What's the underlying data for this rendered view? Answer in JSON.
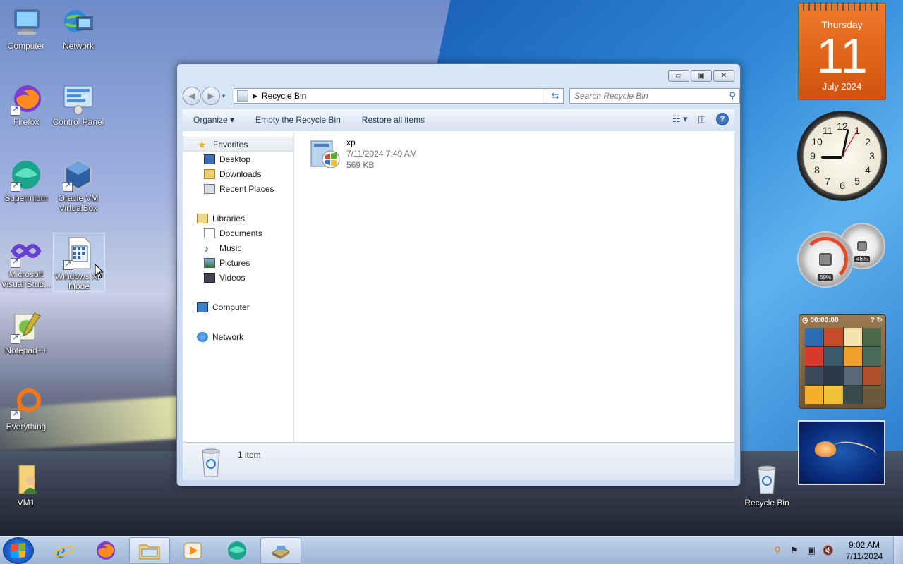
{
  "desktop_icons": [
    {
      "label": "Computer"
    },
    {
      "label": "Network"
    },
    {
      "label": "Firefox"
    },
    {
      "label": "Control Panel"
    },
    {
      "label": "Supermium"
    },
    {
      "label": "Oracle VM VirtualBox"
    },
    {
      "label": "Microsoft Visual Stud..."
    },
    {
      "label": "Windows XP Mode"
    },
    {
      "label": "Notepad++"
    },
    {
      "label": "Everything"
    },
    {
      "label": "VM1"
    },
    {
      "label": "Recycle Bin"
    }
  ],
  "window": {
    "address": "Recycle Bin",
    "search_placeholder": "Search Recycle Bin",
    "toolbar": {
      "organize": "Organize",
      "empty": "Empty the Recycle Bin",
      "restore": "Restore all items"
    },
    "nav": {
      "favorites": "Favorites",
      "desktop": "Desktop",
      "downloads": "Downloads",
      "recent": "Recent Places",
      "libraries": "Libraries",
      "documents": "Documents",
      "music": "Music",
      "pictures": "Pictures",
      "videos": "Videos",
      "computer": "Computer",
      "network": "Network"
    },
    "file": {
      "name": "xp",
      "date": "7/11/2024 7:49 AM",
      "size": "569 KB"
    },
    "status": "1 item"
  },
  "gadgets": {
    "calendar": {
      "weekday": "Thursday",
      "day": "11",
      "month_year": "July 2024"
    },
    "cpu_meter": {
      "cpu": "59%",
      "memory": "46%"
    },
    "puzzle": {
      "timer": "00:00:00"
    }
  },
  "taskbar": {
    "time": "9:02 AM",
    "date": "7/11/2024"
  }
}
